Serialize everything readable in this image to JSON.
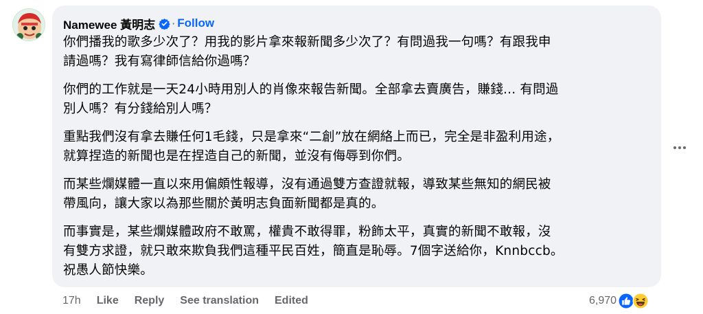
{
  "comment": {
    "author": "Namewee 黃明志",
    "verified_icon": "verified-badge-icon",
    "separator": "·",
    "follow_label": "Follow",
    "paragraphs": [
      {
        "lines": [
          "你們播我的歌多少次了？用我的影片拿來報新聞多少次了？有問過我一句嗎？有跟我申",
          "請過嗎？我有寫律師信給你過嗎？"
        ]
      },
      {
        "lines": [
          "你們的工作就是一天24小時用別人的肖像來報告新聞。全部拿去賣廣告，賺錢... 有問過",
          "別人嗎？有分錢給別人嗎？"
        ]
      },
      {
        "lines": [
          "重點我們沒有拿去賺任何1毛錢，只是拿來“二創”放在網絡上而已，完全是非盈利用途，",
          "就算捏造的新聞也是在捏造自己的新聞，並沒有侮辱到你們。"
        ]
      },
      {
        "lines": [
          "而某些爛媒體一直以來用偏頗性報導，沒有通過雙方查證就報，導致某些無知的網民被",
          "帶風向，讓大家以為那些關於黃明志負面新聞都是真的。"
        ]
      },
      {
        "lines": [
          "而事實是，某些爛媒體政府不敢罵，權貴不敢得罪，粉飾太平，真實的新聞不敢報，沒",
          "有雙方求證，就只敢來欺負我們這種平民百姓，簡直是恥辱。7個字送給你，Knnbccb。",
          "祝愚人節快樂。"
        ]
      }
    ]
  },
  "actions": {
    "timestamp": "17h",
    "like_label": "Like",
    "reply_label": "Reply",
    "translate_label": "See translation",
    "edited_label": "Edited"
  },
  "reactions": {
    "count": "6,970",
    "icons": [
      "like-icon",
      "haha-icon"
    ]
  },
  "colors": {
    "bubble_bg": "#f0f2f5",
    "link_blue": "#0866ff",
    "secondary_text": "#65676b"
  }
}
